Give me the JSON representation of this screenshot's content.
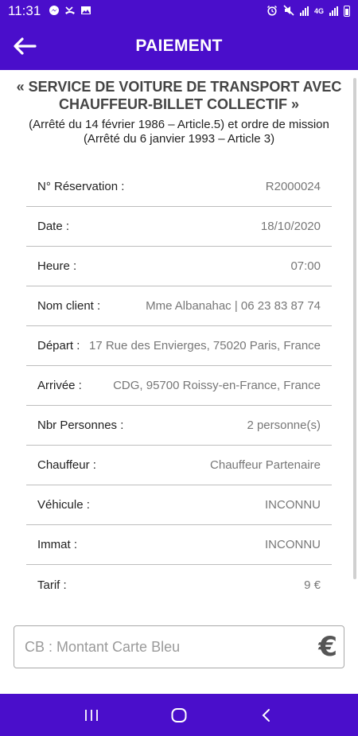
{
  "status_bar": {
    "time": "11:31",
    "network_label": "4G"
  },
  "app_bar": {
    "title": "PAIEMENT"
  },
  "header": {
    "title": "« SERVICE DE VOITURE DE TRANSPORT AVEC CHAUFFEUR-BILLET COLLECTIF »",
    "subtitle_line1": "(Arrêté du 14 février 1986 – Article.5) et ordre de mission",
    "subtitle_line2": "(Arrêté du 6 janvier 1993 – Article 3)"
  },
  "details": [
    {
      "label": "N° Réservation :",
      "value": "R2000024"
    },
    {
      "label": "Date :",
      "value": "18/10/2020"
    },
    {
      "label": "Heure :",
      "value": "07:00"
    },
    {
      "label": "Nom client :",
      "value": "Mme Albanahac | 06 23 83 87 74"
    },
    {
      "label": "Départ :",
      "value": "17 Rue des Envierges, 75020 Paris, France"
    },
    {
      "label": "Arrivée :",
      "value": "CDG, 95700 Roissy-en-France, France"
    },
    {
      "label": "Nbr Personnes :",
      "value": "2  personne(s)"
    },
    {
      "label": "Chauffeur :",
      "value": "Chauffeur Partenaire"
    },
    {
      "label": "Véhicule :",
      "value": "INCONNU"
    },
    {
      "label": "Immat :",
      "value": "INCONNU"
    },
    {
      "label": "Tarif :",
      "value": "9  €"
    }
  ],
  "payment_input": {
    "placeholder": "CB : Montant Carte Bleu",
    "value": "",
    "currency_symbol": "€"
  },
  "colors": {
    "primary": "#4a0ecb"
  }
}
